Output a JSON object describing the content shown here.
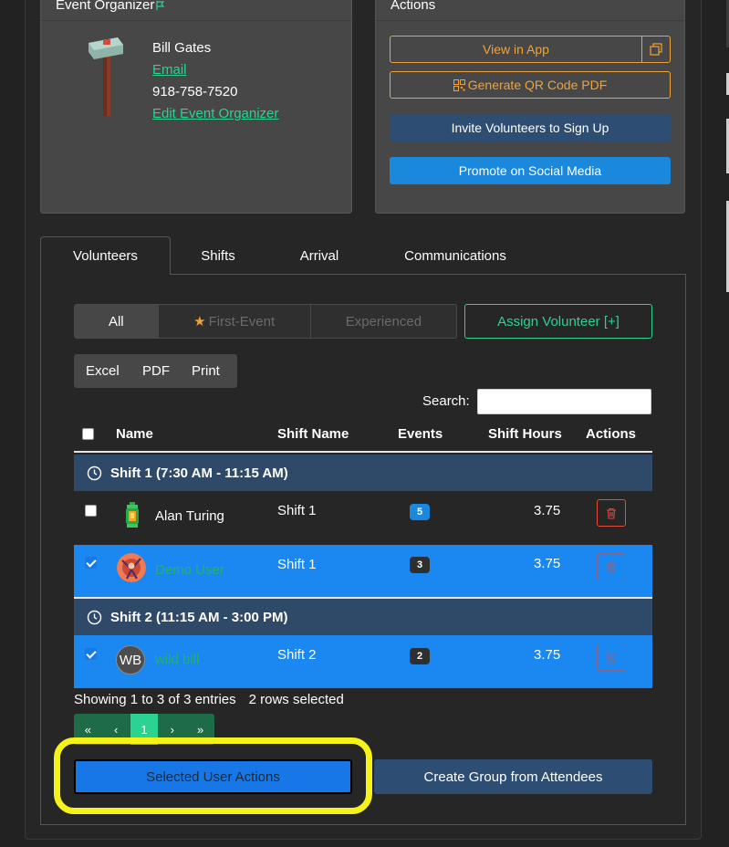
{
  "organizer": {
    "title": "Event Organizer",
    "name": "Bill Gates",
    "email_link": "Email",
    "phone": "918-758-7520",
    "edit_link": "Edit Event Organizer"
  },
  "actions": {
    "title": "Actions",
    "view_in_app": "View in App",
    "generate_qr": "Generate QR Code PDF",
    "invite": "Invite Volunteers to Sign Up",
    "promote": "Promote on Social Media"
  },
  "tabs": [
    {
      "label": "Volunteers",
      "active": true
    },
    {
      "label": "Shifts",
      "active": false
    },
    {
      "label": "Arrival",
      "active": false
    },
    {
      "label": "Communications",
      "active": false
    }
  ],
  "filters": {
    "all": "All",
    "first_event": "First-Event",
    "experienced": "Experienced",
    "assign": "Assign Volunteer [+]"
  },
  "export": {
    "excel": "Excel",
    "pdf": "PDF",
    "print": "Print"
  },
  "search": {
    "label": "Search:",
    "value": ""
  },
  "table": {
    "headers": {
      "name": "Name",
      "shift_name": "Shift Name",
      "events": "Events",
      "shift_hours": "Shift Hours",
      "actions": "Actions"
    },
    "groups": [
      {
        "label": "Shift 1 (7:30 AM - 11:15 AM)",
        "rows": [
          {
            "name": "Alan Turing",
            "shift": "Shift 1",
            "events": "5",
            "hours": "3.75",
            "selected": false,
            "avatar": "lantern-icon"
          },
          {
            "name": "Demo User",
            "shift": "Shift 1",
            "events": "3",
            "hours": "3.75",
            "selected": true,
            "avatar": "demo-avatar"
          }
        ]
      },
      {
        "label": "Shift 2 (11:15 AM - 3:00 PM)",
        "rows": [
          {
            "name": "wild bill",
            "shift": "Shift 2",
            "events": "2",
            "hours": "3.75",
            "selected": true,
            "avatar_initials": "WB"
          }
        ]
      }
    ]
  },
  "footer": {
    "showing": "Showing 1 to 3 of 3 entries",
    "selected": "2 rows selected",
    "pagination": {
      "first": "«",
      "prev": "‹",
      "current": "1",
      "next": "›",
      "last": "»"
    },
    "selected_actions": "Selected User Actions",
    "create_group": "Create Group from Attendees"
  },
  "colors": {
    "accent_green": "#2ad38f",
    "accent_orange": "#f0a23a",
    "selected_row": "#1a88f0",
    "group_row": "#2f4a68",
    "highlight": "#f5f21a",
    "danger": "#e64b3b"
  }
}
